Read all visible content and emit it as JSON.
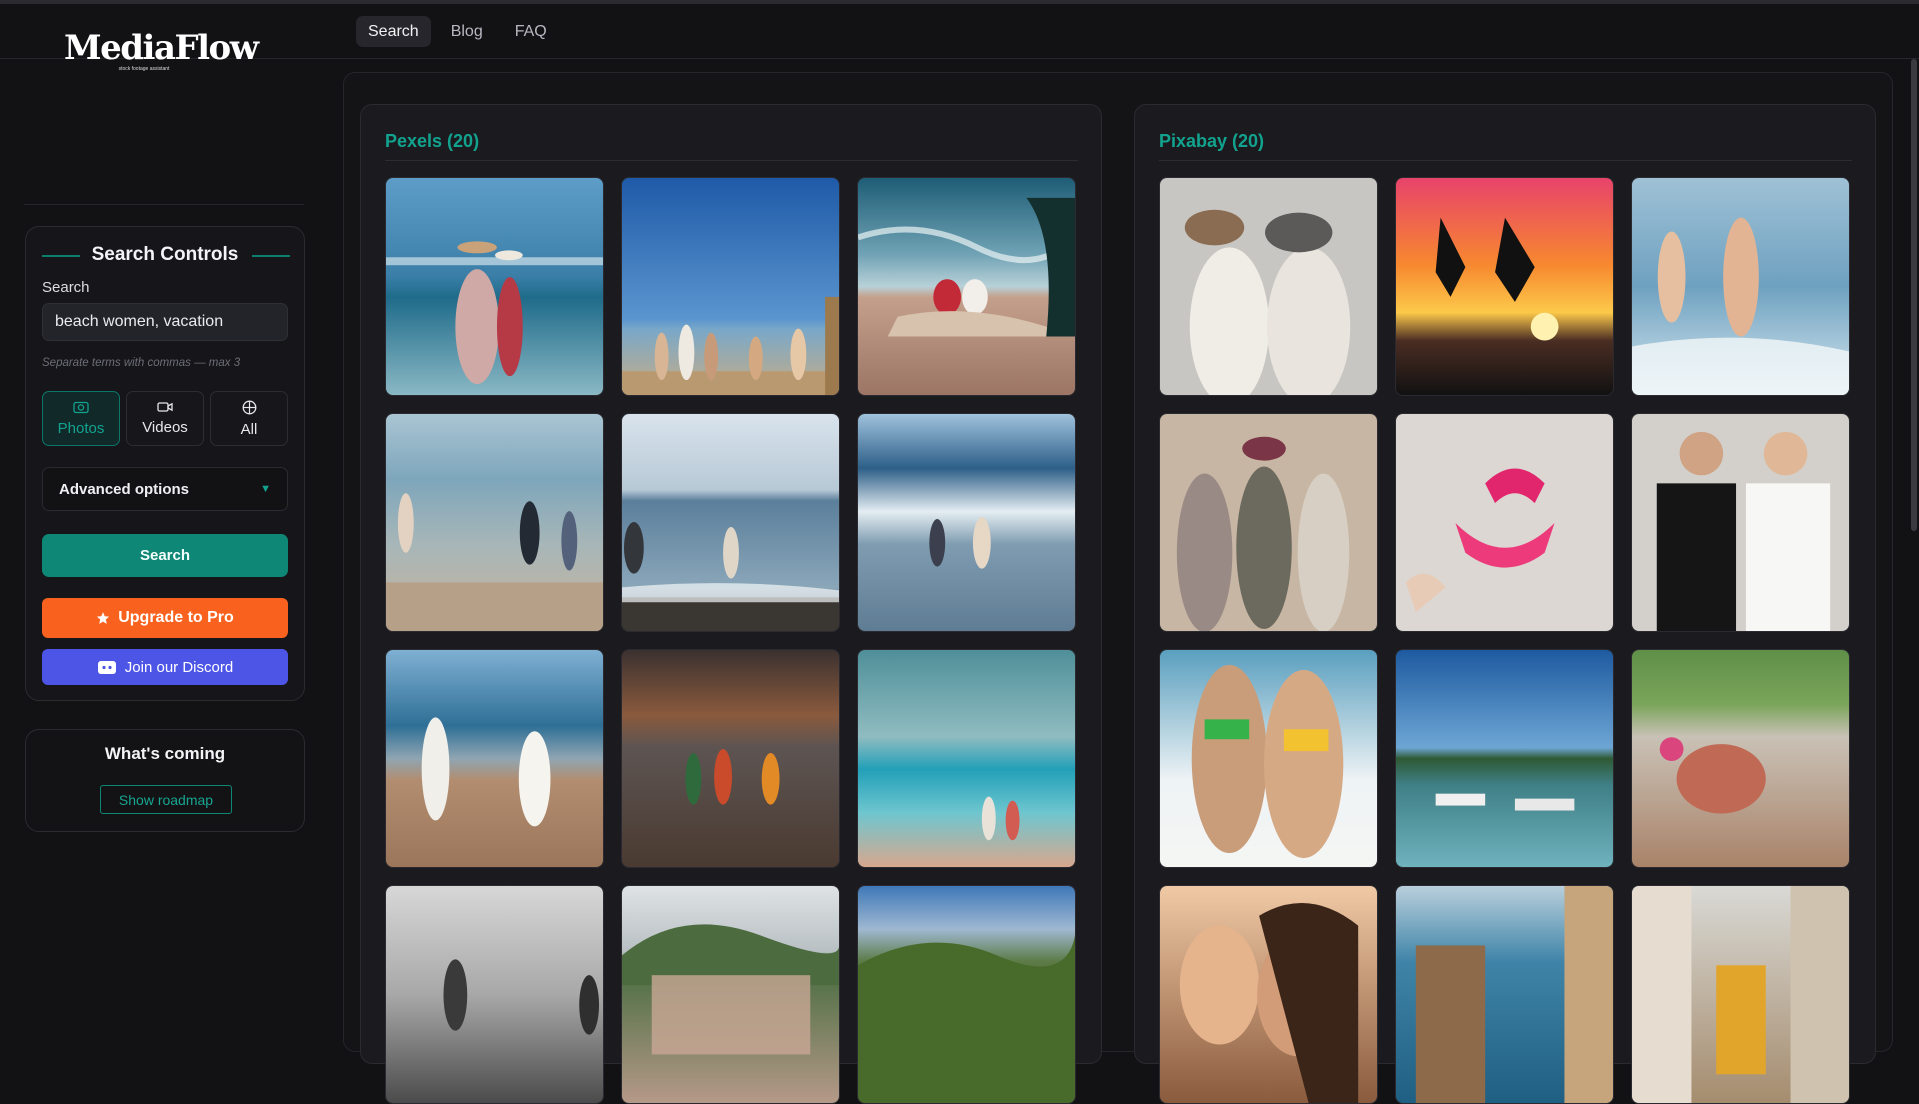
{
  "nav": {
    "items": [
      {
        "label": "Search",
        "active": true
      },
      {
        "label": "Blog",
        "active": false
      },
      {
        "label": "FAQ",
        "active": false
      }
    ]
  },
  "brand": {
    "name": "MediaFlow",
    "tagline": "stock footage assistant"
  },
  "search_controls": {
    "title": "Search Controls",
    "search_label": "Search",
    "search_value": "beach women, vacation",
    "hint": "Separate terms with commas — max 3",
    "types": [
      {
        "label": "Photos",
        "icon": "camera-icon",
        "active": true
      },
      {
        "label": "Videos",
        "icon": "video-icon",
        "active": false
      },
      {
        "label": "All",
        "icon": "globe-icon",
        "active": false
      }
    ],
    "advanced_label": "Advanced options",
    "search_button": "Search",
    "upgrade_button": "Upgrade to Pro",
    "discord_button": "Join our Discord"
  },
  "whats_coming": {
    "title": "What's coming",
    "button": "Show roadmap"
  },
  "results": {
    "pexels": {
      "title": "Pexels (20)",
      "images": [
        "women-wading-beach",
        "group-women-beach-blue-sky",
        "two-women-sitting-beach",
        "women-walking-shoreline",
        "women-standing-in-sea",
        "two-women-in-waves",
        "women-dancing-beach",
        "three-women-carrying-baskets",
        "two-women-walking-turquoise-sea",
        "bw-person-on-beach",
        "hillside-coastal-town",
        "green-mountain-valley"
      ]
    },
    "pixabay": {
      "title": "Pixabay (20)",
      "images": [
        "two-women-hats-shore",
        "silhouettes-jumping-sunset",
        "two-women-running-into-sea",
        "three-women-hats-beach",
        "pink-bikini-on-sand",
        "two-women-posing-beach",
        "two-women-bikinis-posing",
        "boats-palm-trees-lagoon",
        "woman-digging-shore",
        "three-women-smiling",
        "beach-kiosk-sea-view",
        "narrow-street-tram"
      ]
    }
  },
  "colors": {
    "accent": "#0f8776",
    "pro": "#f9621e",
    "discord": "#4d55e6",
    "background": "#121215"
  }
}
